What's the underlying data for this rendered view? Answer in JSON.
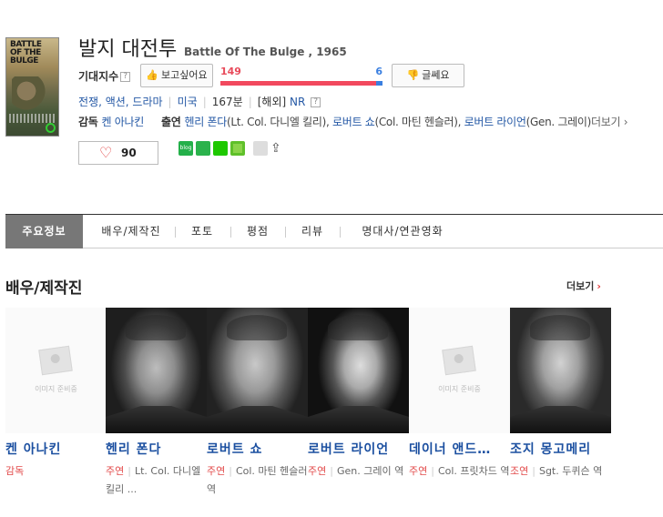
{
  "movie": {
    "title_ko": "발지 대전투",
    "title_en": "Battle Of The Bulge , 1965",
    "poster_text": "BATTLE OF THE BULGE"
  },
  "rating": {
    "label": "기대지수",
    "qmark": "?",
    "want_label": "보고싶어요",
    "want_count": "149",
    "hate_count": "6",
    "hate_label": "글쎄요",
    "want_ratio": 0.96
  },
  "info": {
    "genres": "전쟁, 액션, 드라마",
    "country": "미국",
    "runtime": "167분",
    "grade_prefix": "[해외]",
    "grade": "NR",
    "qmark": "?"
  },
  "credits": {
    "director_label": "감독",
    "director": "켄 아나킨",
    "cast_label": "출연",
    "cast": [
      {
        "name": "헨리 폰다",
        "role": "(Lt. Col. 다니엘 킬리),"
      },
      {
        "name": "로버트 쇼",
        "role": "(Col. 마틴 헨슬러),"
      },
      {
        "name": "로버트 라이언",
        "role": "(Gen. 그레이)"
      }
    ],
    "more": "더보기"
  },
  "like": {
    "count": "90"
  },
  "share": {
    "blog": "blog"
  },
  "tabs": [
    "주요정보",
    "배우/제작진",
    "포토",
    "평점",
    "리뷰",
    "명대사/연관영화"
  ],
  "section": {
    "title": "배우/제작진",
    "more": "더보기"
  },
  "people": [
    {
      "name": "켄 아나킨",
      "kind": "감독",
      "role": "",
      "photo": "placeholder",
      "placeholder_text": "이미지 준비중"
    },
    {
      "name": "헨리 폰다",
      "kind": "주연",
      "role": "Lt. Col. 다니엘 킬리 ...",
      "photo": "bw"
    },
    {
      "name": "로버트 쇼",
      "kind": "주연",
      "role": "Col. 마틴 헨슬러 역",
      "photo": "bw"
    },
    {
      "name": "로버트 라이언",
      "kind": "주연",
      "role": "Gen. 그레이 역",
      "photo": "bw"
    },
    {
      "name": "데이너 앤드…",
      "kind": "주연",
      "role": "Col. 프릿차드 역",
      "photo": "placeholder",
      "placeholder_text": "이미지 준비중"
    },
    {
      "name": "조지 몽고메리",
      "kind": "조연",
      "role": "Sgt. 두퀴슨 역",
      "photo": "bw"
    }
  ]
}
